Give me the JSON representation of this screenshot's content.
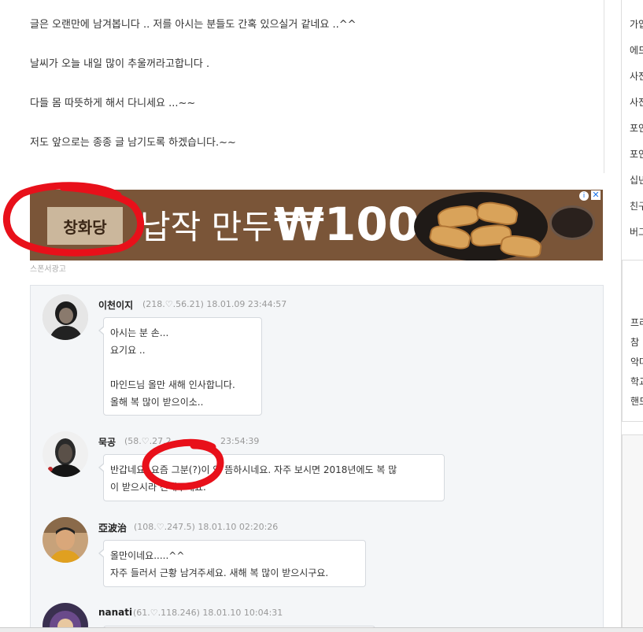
{
  "post": {
    "lines": [
      "글은 오랜만에 남겨봅니다 .. 저를 아시는 분들도 간혹 있으실거 같네요 ..^^",
      "날씨가 오늘 내일 많이 추울꺼라고합니다 .",
      "다들 몸 따뜻하게 해서 다니세요 ...~~",
      "저도 앞으로는 종종 글 남기도록 하겠습니다.~~"
    ]
  },
  "ad": {
    "brand": "창화당",
    "text": "납작 만두",
    "price": "₩100",
    "sponsor_label": "스폰서광고"
  },
  "comments": [
    {
      "nick": "이천이지",
      "meta": "(218.♡.56.21) 18.01.09 23:44:57",
      "lines": [
        "아시는 분 손...",
        "요기요 ..",
        "",
        "마인드님 올만 새해 인사합니다.",
        "올해 복 많이 받으이소.."
      ]
    },
    {
      "nick": "묵공",
      "meta": "(58.♡.27.2",
      "meta_tail": "23:54:39",
      "lines": [
        "반갑네요. 요즘 그분(?)이 영 뜸하시네요. 자주 보시면 2018년에도 복 많",
        "이 받으시라 전해주세요."
      ]
    },
    {
      "nick": "亞波治",
      "meta": "(108.♡.247.5) 18.01.10 02:20:26",
      "lines": [
        "올만이네요.....^^",
        "자주 들러서 근황 남겨주세요. 새해 복 많이 받으시구요."
      ]
    },
    {
      "nick": "nanati",
      "meta": "(61.♡.118.246) 18.01.10 10:04:31",
      "lines": []
    }
  ],
  "sidebar": {
    "items": [
      "가입",
      "에드",
      "사전",
      "사진",
      "포인",
      "포인",
      "십년",
      "친구",
      "버그",
      "프리",
      "참",
      "악마",
      "학교",
      "핸드"
    ]
  },
  "colors": {
    "ad_bg": "#7a5538",
    "annotation_red": "#e8101a",
    "comment_bg": "#f4f6f8"
  }
}
